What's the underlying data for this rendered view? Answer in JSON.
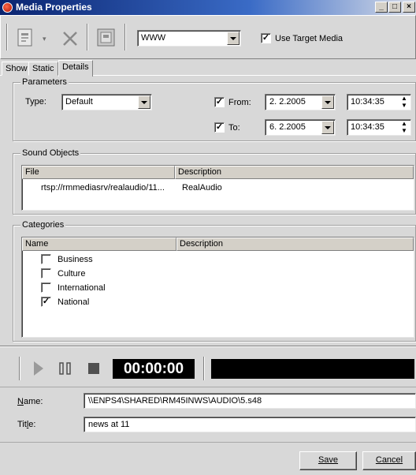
{
  "window": {
    "title": "Media Properties",
    "caption_buttons": [
      "_",
      "□",
      "×"
    ]
  },
  "toolbar": {
    "combo_value": "WWW",
    "use_target_media_label": "Use Target Media",
    "use_target_media_checked": true
  },
  "tabs": [
    {
      "label": "Show"
    },
    {
      "label": "Static"
    },
    {
      "label": "Details",
      "active": true
    }
  ],
  "parameters": {
    "group_label": "Parameters",
    "type_label": "Type:",
    "type_value": "Default",
    "from_label": "From:",
    "from_checked": true,
    "from_date": "2. 2.2005",
    "from_time": "10:34:35",
    "to_label": "To:",
    "to_checked": true,
    "to_date": "6. 2.2005",
    "to_time": "10:34:35"
  },
  "sound_objects": {
    "group_label": "Sound Objects",
    "columns": [
      "File",
      "Description"
    ],
    "rows": [
      {
        "file": "rtsp://rmmediasrv/realaudio/11...",
        "description": "RealAudio"
      }
    ]
  },
  "categories": {
    "group_label": "Categories",
    "columns": [
      "Name",
      "Description"
    ],
    "items": [
      {
        "name": "Business",
        "checked": false
      },
      {
        "name": "Culture",
        "checked": false
      },
      {
        "name": "International",
        "checked": false
      },
      {
        "name": "National",
        "checked": true
      }
    ]
  },
  "player": {
    "timecode": "00:00:00"
  },
  "form": {
    "name_label": "Name:",
    "name_value": "\\\\ENPS4\\SHARED\\RM45INWS\\AUDIO\\5.s48",
    "title_label": "Title:",
    "title_value": "news at 11"
  },
  "buttons": {
    "save": "Save",
    "cancel": "Cancel"
  },
  "colors": {
    "title_gradient_start": "#0a2470",
    "timecode_bg": "#000000",
    "timecode_fg": "#ffffff"
  }
}
